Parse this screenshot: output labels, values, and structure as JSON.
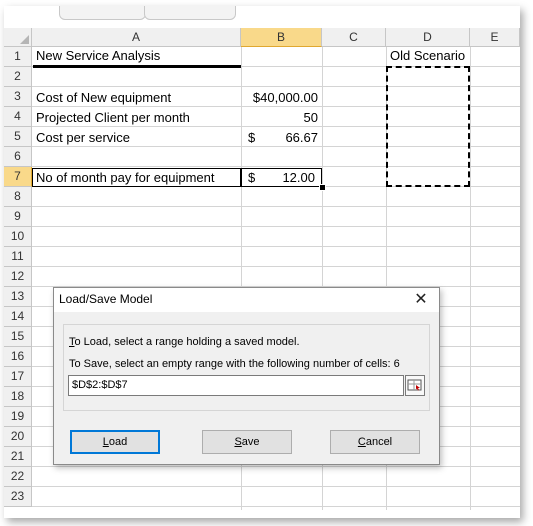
{
  "spreadsheet": {
    "columns": [
      "A",
      "B",
      "C",
      "D",
      "E"
    ],
    "rows": [
      "1",
      "2",
      "3",
      "4",
      "5",
      "6",
      "7",
      "8",
      "9",
      "10",
      "11",
      "12",
      "13",
      "14",
      "15",
      "16",
      "17",
      "18",
      "19",
      "20",
      "21",
      "22",
      "23"
    ],
    "cells": {
      "a1": "New Service Analysis",
      "d1": "Old Scenario",
      "a3": "Cost of New equipment",
      "b3": "$40,000.00",
      "a4": "Projected Client per month",
      "b4": "50",
      "a5": "Cost per service",
      "b5_currency": "$",
      "b5_value": "66.67",
      "a7": "No of month pay for equipment",
      "b7_currency": "$",
      "b7_value": "12.00"
    }
  },
  "dialog": {
    "title": "Load/Save Model",
    "close_glyph": "✕",
    "load_instruction_first": "T",
    "load_instruction_rest": "o Load, select a range holding a saved model.",
    "save_instruction": "To Save, select an empty range with the following number of cells: 6",
    "range_value": "$D$2:$D$7",
    "buttons": {
      "load_u": "L",
      "load_rest": "oad",
      "save_u": "S",
      "save_rest": "ave",
      "cancel_u": "C",
      "cancel_rest": "ancel"
    }
  },
  "colors": {
    "selected_header": "#f9d98a",
    "grid_line": "#d4d4d4",
    "dialog_bg": "#f0f0f0",
    "default_button_border": "#0078d7"
  }
}
